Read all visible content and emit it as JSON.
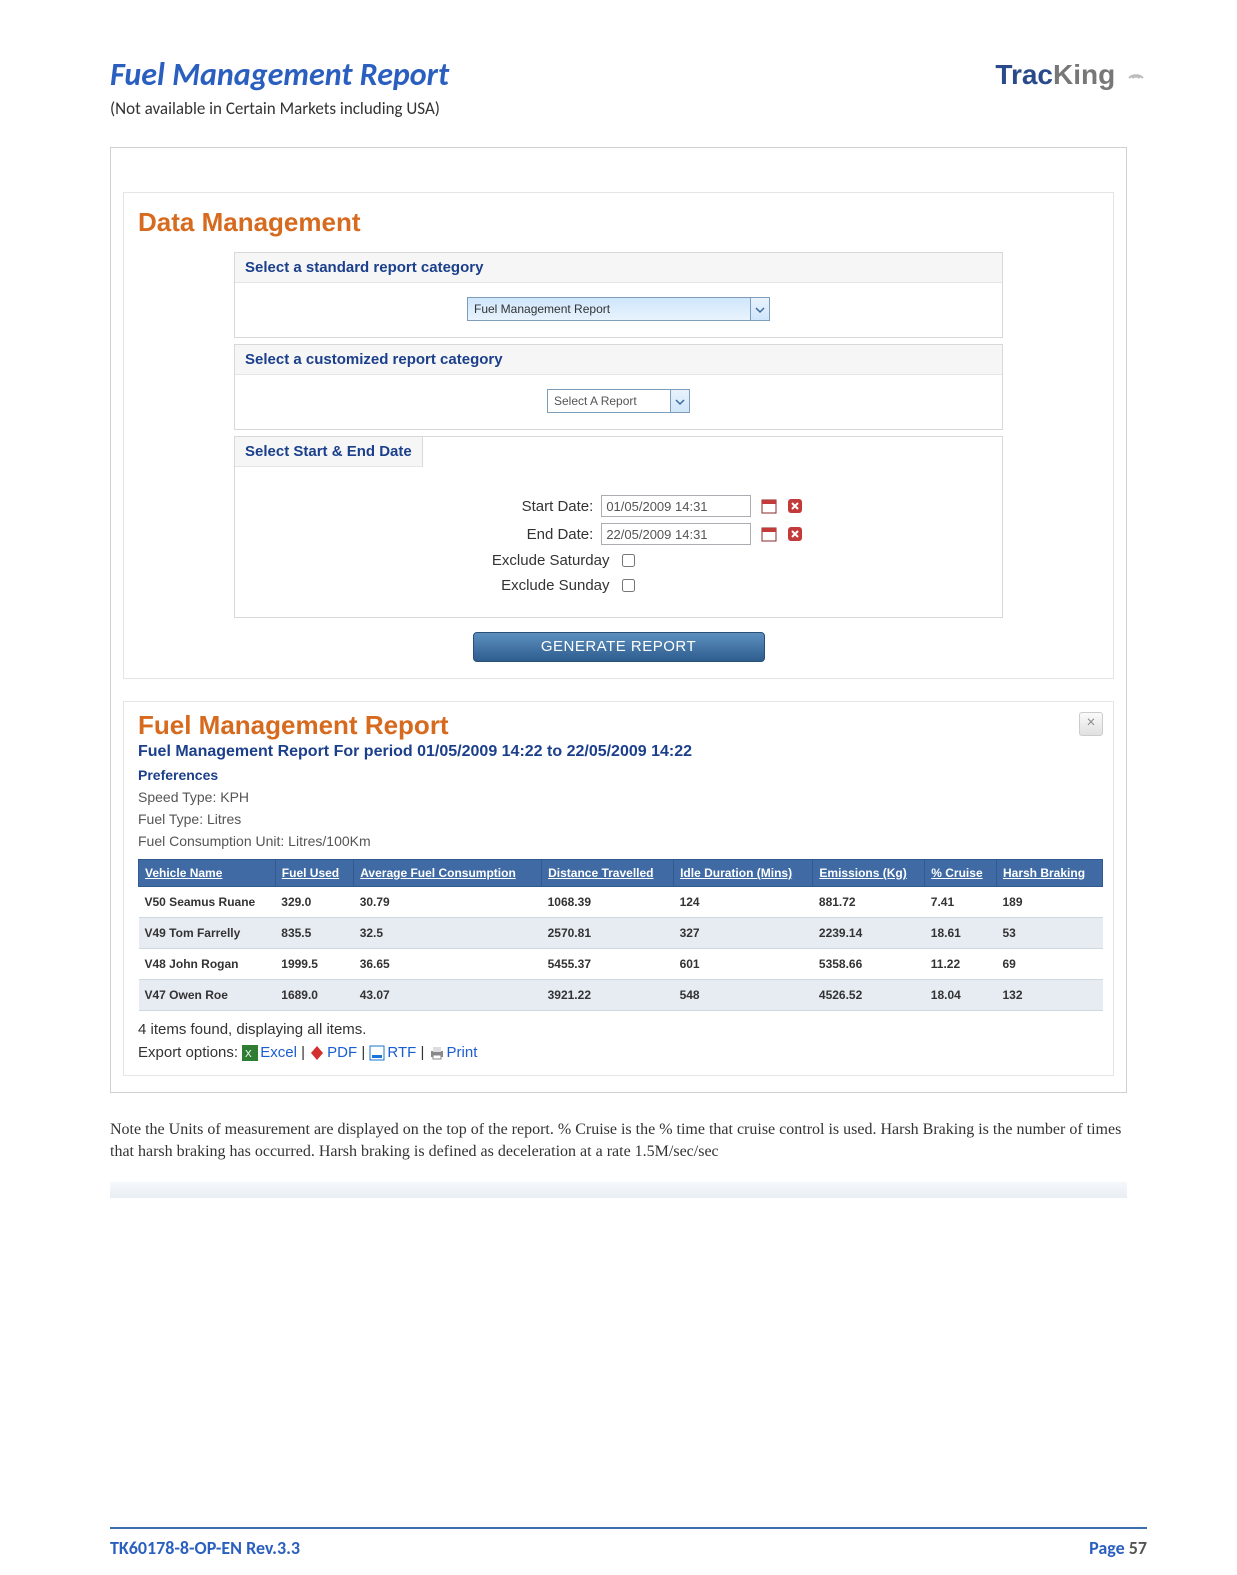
{
  "logo": {
    "part1": "Trac",
    "part2": "King"
  },
  "section_title": "Fuel Management Report",
  "section_subnote": "(Not available in Certain Markets including USA)",
  "dm": {
    "heading": "Data Management",
    "standard_label": "Select a standard report category",
    "standard_value": "Fuel Management Report",
    "custom_label": "Select a customized report category",
    "custom_value": "Select A Report",
    "dates_label": "Select Start & End Date",
    "start_label": "Start Date:",
    "start_value": "01/05/2009 14:31",
    "end_label": "End Date:",
    "end_value": "22/05/2009 14:31",
    "ex_sat_label": "Exclude Saturday",
    "ex_sun_label": "Exclude Sunday",
    "generate_label": "GENERATE REPORT"
  },
  "report": {
    "title": "Fuel Management Report",
    "period": "Fuel Management Report For period 01/05/2009 14:22 to 22/05/2009 14:22",
    "pref_label": "Preferences",
    "meta1": "Speed Type: KPH",
    "meta2": "Fuel Type: Litres",
    "meta3": "Fuel Consumption Unit: Litres/100Km",
    "headers": [
      "Vehicle Name",
      "Fuel Used",
      "Average Fuel Consumption",
      "Distance Travelled",
      "Idle Duration (Mins)",
      "Emissions (Kg)",
      "% Cruise",
      "Harsh Braking"
    ],
    "rows": [
      [
        "V50 Seamus Ruane",
        "329.0",
        "30.79",
        "1068.39",
        "124",
        "881.72",
        "7.41",
        "189"
      ],
      [
        "V49 Tom Farrelly",
        "835.5",
        "32.5",
        "2570.81",
        "327",
        "2239.14",
        "18.61",
        "53"
      ],
      [
        "V48 John Rogan",
        "1999.5",
        "36.65",
        "5455.37",
        "601",
        "5358.66",
        "11.22",
        "69"
      ],
      [
        "V47 Owen Roe",
        "1689.0",
        "43.07",
        "3921.22",
        "548",
        "4526.52",
        "18.04",
        "132"
      ]
    ],
    "pager": "4 items found, displaying all items.",
    "export_prefix": "Export options:",
    "export_links": {
      "excel": "Excel",
      "pdf": "PDF",
      "rtf": "RTF",
      "print": "Print"
    }
  },
  "note": "Note the Units of measurement are displayed on the top of the report. % Cruise is the % time that cruise control is used. Harsh Braking is the number of times that harsh braking has occurred. Harsh braking is defined as deceleration at a rate 1.5M/sec/sec",
  "footer": {
    "docid": "TK60178-8-OP-EN Rev.3.3",
    "page_label": "Page ",
    "page_num": "57"
  },
  "chart_data": {
    "type": "table",
    "title": "Fuel Management Report For period 01/05/2009 14:22 to 22/05/2009 14:22",
    "columns": [
      "Vehicle Name",
      "Fuel Used",
      "Average Fuel Consumption",
      "Distance Travelled",
      "Idle Duration (Mins)",
      "Emissions (Kg)",
      "% Cruise",
      "Harsh Braking"
    ],
    "rows": [
      {
        "Vehicle Name": "V50 Seamus Ruane",
        "Fuel Used": 329.0,
        "Average Fuel Consumption": 30.79,
        "Distance Travelled": 1068.39,
        "Idle Duration (Mins)": 124,
        "Emissions (Kg)": 881.72,
        "% Cruise": 7.41,
        "Harsh Braking": 189
      },
      {
        "Vehicle Name": "V49 Tom Farrelly",
        "Fuel Used": 835.5,
        "Average Fuel Consumption": 32.5,
        "Distance Travelled": 2570.81,
        "Idle Duration (Mins)": 327,
        "Emissions (Kg)": 2239.14,
        "% Cruise": 18.61,
        "Harsh Braking": 53
      },
      {
        "Vehicle Name": "V48 John Rogan",
        "Fuel Used": 1999.5,
        "Average Fuel Consumption": 36.65,
        "Distance Travelled": 5455.37,
        "Idle Duration (Mins)": 601,
        "Emissions (Kg)": 5358.66,
        "% Cruise": 11.22,
        "Harsh Braking": 69
      },
      {
        "Vehicle Name": "V47 Owen Roe",
        "Fuel Used": 1689.0,
        "Average Fuel Consumption": 43.07,
        "Distance Travelled": 3921.22,
        "Idle Duration (Mins)": 548,
        "Emissions (Kg)": 4526.52,
        "% Cruise": 18.04,
        "Harsh Braking": 132
      }
    ]
  }
}
